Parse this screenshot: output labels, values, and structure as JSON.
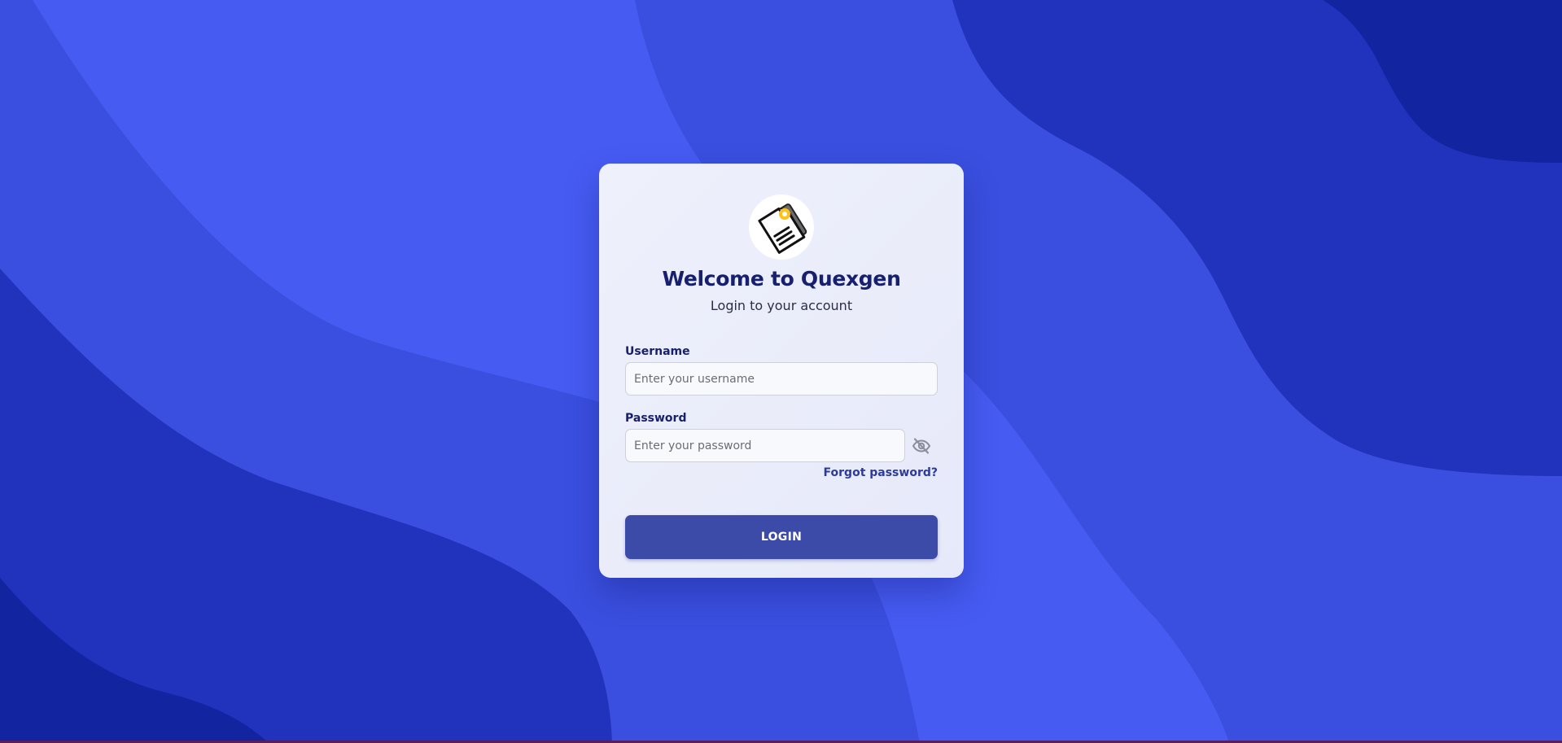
{
  "app": {
    "title": "Welcome to Quexgen",
    "subtitle": "Login to your account",
    "logo_icon": "document-icon"
  },
  "colors": {
    "background": "#3a4fdf",
    "title": "#17206e",
    "button": "#3c4ba8",
    "link": "#2c3a9e"
  },
  "form": {
    "username": {
      "label": "Username",
      "placeholder": "Enter your username",
      "value": ""
    },
    "password": {
      "label": "Password",
      "placeholder": "Enter your password",
      "value": "",
      "toggle_icon": "eye-off-icon"
    },
    "forgot_label": "Forgot password?",
    "login_label": "LOGIN"
  }
}
